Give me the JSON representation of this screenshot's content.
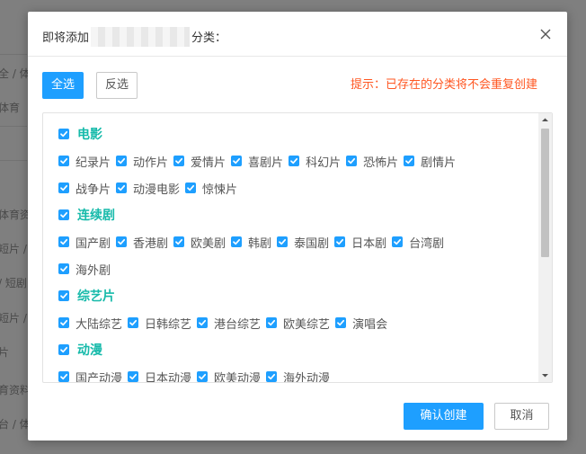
{
  "background": {
    "fragments": [
      "全 / 体",
      "体育",
      "体育资",
      "短片 / 1",
      "/ 短剧",
      "短片 / 1",
      "片",
      "育资料",
      "台 / 体育"
    ]
  },
  "dialog": {
    "title_prefix": "即将添加",
    "title_suffix": "分类：",
    "close_icon": "close-icon"
  },
  "toolbar": {
    "select_all_label": "全选",
    "invert_label": "反选",
    "hint": "提示：已存在的分类将不会重复创建"
  },
  "categories": [
    {
      "label": "电影",
      "rows": [
        [
          "纪录片",
          "动作片",
          "爱情片",
          "喜剧片",
          "科幻片",
          "恐怖片",
          "剧情片"
        ],
        [
          "战争片",
          "动漫电影",
          "惊悚片"
        ]
      ]
    },
    {
      "label": "连续剧",
      "rows": [
        [
          "国产剧",
          "香港剧",
          "欧美剧",
          "韩剧",
          "泰国剧",
          "日本剧",
          "台湾剧"
        ],
        [
          "海外剧"
        ]
      ]
    },
    {
      "label": "综艺片",
      "rows": [
        [
          "大陆综艺",
          "日韩综艺",
          "港台综艺",
          "欧美综艺",
          "演唱会"
        ]
      ]
    },
    {
      "label": "动漫",
      "rows": [
        [
          "国产动漫",
          "日本动漫",
          "欧美动漫",
          "海外动漫"
        ]
      ]
    }
  ],
  "footer": {
    "confirm_label": "确认创建",
    "cancel_label": "取消"
  },
  "colors": {
    "primary": "#1e9fff",
    "category_label": "#16baaa",
    "hint": "#ff5722"
  }
}
